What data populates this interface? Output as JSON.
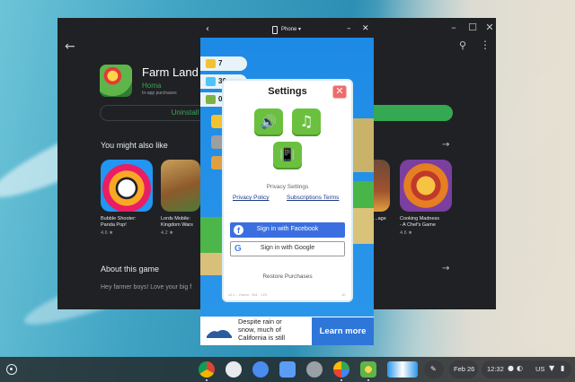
{
  "play_store": {
    "app_title": "Farm Land -",
    "developer": "Homa",
    "subtitle": "In-app purchases",
    "uninstall_label": "Uninstall",
    "recommend_title": "You might also like",
    "recommend_items": [
      {
        "name": "Bubble Shooter:\nPanda Pop!",
        "rating": "4.6 ★"
      },
      {
        "name": "Lords Mobile:\nKingdom Wars",
        "rating": "4.2 ★"
      },
      {
        "name": "...age",
        "rating": ""
      },
      {
        "name": "Cooking Madness\n- A Chef's Game",
        "rating": "4.6 ★"
      }
    ],
    "about_title": "About this game",
    "about_text": "Hey farmer boys! Love your big f"
  },
  "game_window": {
    "title": "Phone ▾",
    "resources": [
      "7",
      "30",
      "0"
    ]
  },
  "settings": {
    "title": "Settings",
    "close": "✕",
    "privacy_heading": "Privacy Settings",
    "privacy_policy": "Privacy Policy",
    "subscriptions_terms": "Subscriptions Terms",
    "facebook_label": "Sign in with Facebook",
    "google_label": "Sign in with Google",
    "restore_label": "Restore Purchases",
    "version": "v2.1 ⁠– Homa · 0b1 · 123",
    "version_right": "10"
  },
  "ad": {
    "text": "Despite rain or\nsnow, much of\nCalifornia is still",
    "cta": "Learn more"
  },
  "shelf": {
    "date": "Feb 26",
    "time": "12:32",
    "locale": "US"
  },
  "icons": {
    "back": "←",
    "search": "⚲",
    "more": "⋮",
    "arrow_right": "→",
    "speaker": "🔊",
    "music": "♫",
    "vibrate": "📳"
  },
  "colors": {
    "play_green": "#34a853",
    "dialog_green": "#6bc13f",
    "facebook_blue": "#3b6fe0",
    "ad_blue": "#2f76d9"
  }
}
